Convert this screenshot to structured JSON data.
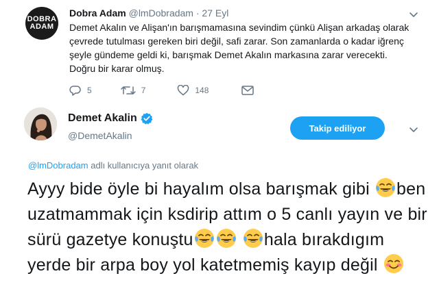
{
  "quoted_tweet": {
    "avatar_lines": [
      "DOBRA",
      "ADAM"
    ],
    "name": "Dobra Adam",
    "handle": "@lmDobradam",
    "separator": "·",
    "time": "27 Eyl",
    "text": "Demet Akalın ve Alişan'ın barışmamasına sevindim çünkü Alişan arkadaş olarak çevrede tutulması gereken biri değil, safi zarar. Son zamanlarda o kadar iğrenç şeyle gündeme geldi ki, barışmak Demet Akalın markasına zarar verecekti. Doğru bir karar olmuş.",
    "actions": {
      "reply_count": "5",
      "retweet_count": "7",
      "like_count": "148"
    }
  },
  "main_tweet": {
    "name": "Demet Akalin",
    "handle": "@DemetAkalin",
    "follow_button": "Takip ediliyor",
    "reply_to": {
      "mention": "@lmDobradam",
      "suffix": " adlı kullanıcıya yanıt olarak"
    },
    "text_segments": {
      "s1": "Ayyy bide öyle bi hayalım olsa barışmak gibi",
      "s2": "ben uzatmammak için ksdirip attım o 5 canlı yayın ve bir sürü gazetye konuştu",
      "s3": "hala bırakdıgım yerde bir arpa boy yol katetmemiş kayıp değil"
    }
  },
  "colors": {
    "accent": "#1da1f2",
    "text": "#14171a",
    "muted": "#657786"
  },
  "icons": [
    "chevron-down-icon",
    "reply-icon",
    "retweet-icon",
    "like-icon",
    "verified-badge-icon",
    "joy-emoji",
    "smiling-blush-emoji"
  ]
}
